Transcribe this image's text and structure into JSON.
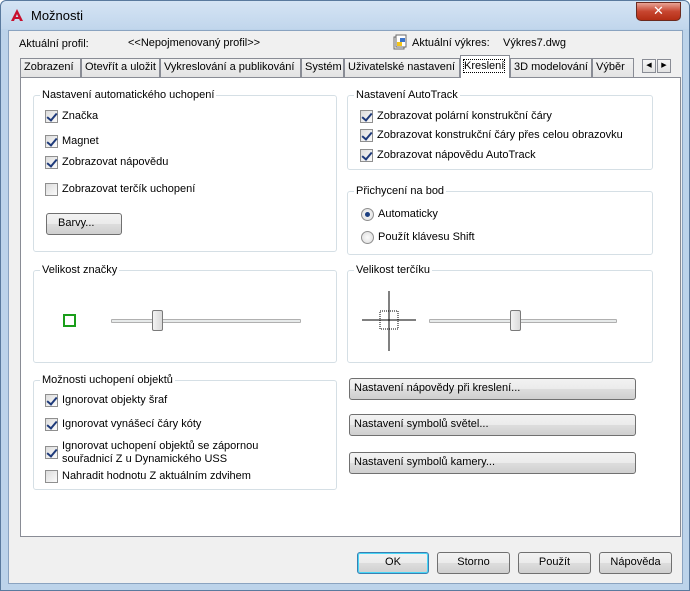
{
  "window": {
    "title": "Možnosti",
    "close_glyph": "✕"
  },
  "profile": {
    "label": "Aktuální profil:",
    "value": "<<Nepojmenovaný profil>>",
    "drawing_label": "Aktuální výkres:",
    "drawing_value": "Výkres7.dwg"
  },
  "tabs": [
    {
      "label": "Zobrazení",
      "active": false
    },
    {
      "label": "Otevřít a uložit",
      "active": false
    },
    {
      "label": "Vykreslování a publikování",
      "active": false
    },
    {
      "label": "Systém",
      "active": false
    },
    {
      "label": "Uživatelské nastavení",
      "active": false
    },
    {
      "label": "Kreslení",
      "active": true
    },
    {
      "label": "3D modelování",
      "active": false
    },
    {
      "label": "Výběr",
      "active": false
    }
  ],
  "tab_scroll": {
    "left": "◀",
    "right": "▶"
  },
  "autosnap": {
    "title": "Nastavení automatického uchopení",
    "marker": {
      "label": "Značka",
      "checked": true
    },
    "magnet": {
      "label": "Magnet",
      "checked": true
    },
    "tooltip": {
      "label": "Zobrazovat nápovědu",
      "checked": true
    },
    "aperture": {
      "label": "Zobrazovat terčík uchopení",
      "checked": false
    },
    "colors_button": "Barvy..."
  },
  "autotrack": {
    "title": "Nastavení AutoTrack",
    "polar": {
      "label": "Zobrazovat polární konstrukční čáry",
      "checked": true
    },
    "fullscreen": {
      "label": "Zobrazovat konstrukční čáry přes celou obrazovku",
      "checked": true
    },
    "tooltip": {
      "label": "Zobrazovat nápovědu AutoTrack",
      "checked": true
    }
  },
  "alignment": {
    "title": "Přichycení na bod",
    "automatic": {
      "label": "Automaticky",
      "selected": true
    },
    "shift": {
      "label": "Použít klávesu Shift",
      "selected": false
    }
  },
  "marker_size": {
    "title": "Velikost značky",
    "slider_fraction": 0.24,
    "preview_color": "#1a9e1a"
  },
  "aperture_size": {
    "title": "Velikost terčíku",
    "slider_fraction": 0.46
  },
  "object_snap": {
    "title": "Možnosti uchopení objektů",
    "hatch": {
      "label": "Ignorovat objekty šraf",
      "checked": true
    },
    "dimext": {
      "label": "Ignorovat vynášecí čáry kóty",
      "checked": true
    },
    "negz_line1": "Ignorovat uchopení objektů se zápornou",
    "negz_line2": "souřadnicí Z u Dynamického USS",
    "negz_checked": true,
    "replacez": {
      "label": "Nahradit hodnotu Z aktuálním zdvihem",
      "checked": false
    }
  },
  "side_buttons": {
    "drafting_tooltip": "Nastavení nápovědy při kreslení...",
    "lights_glyph": "Nastavení symbolů světel...",
    "camera_glyph": "Nastavení symbolů kamery..."
  },
  "footer": {
    "ok": "OK",
    "cancel": "Storno",
    "apply": "Použít",
    "help": "Nápověda"
  },
  "colors": {
    "accent_red": "#c8102e",
    "close_red": "#c7452f",
    "window_blue": "#bcd3ea"
  },
  "icons": {
    "app": "autocad-logo-icon",
    "drawing": "drawing-file-icon"
  }
}
